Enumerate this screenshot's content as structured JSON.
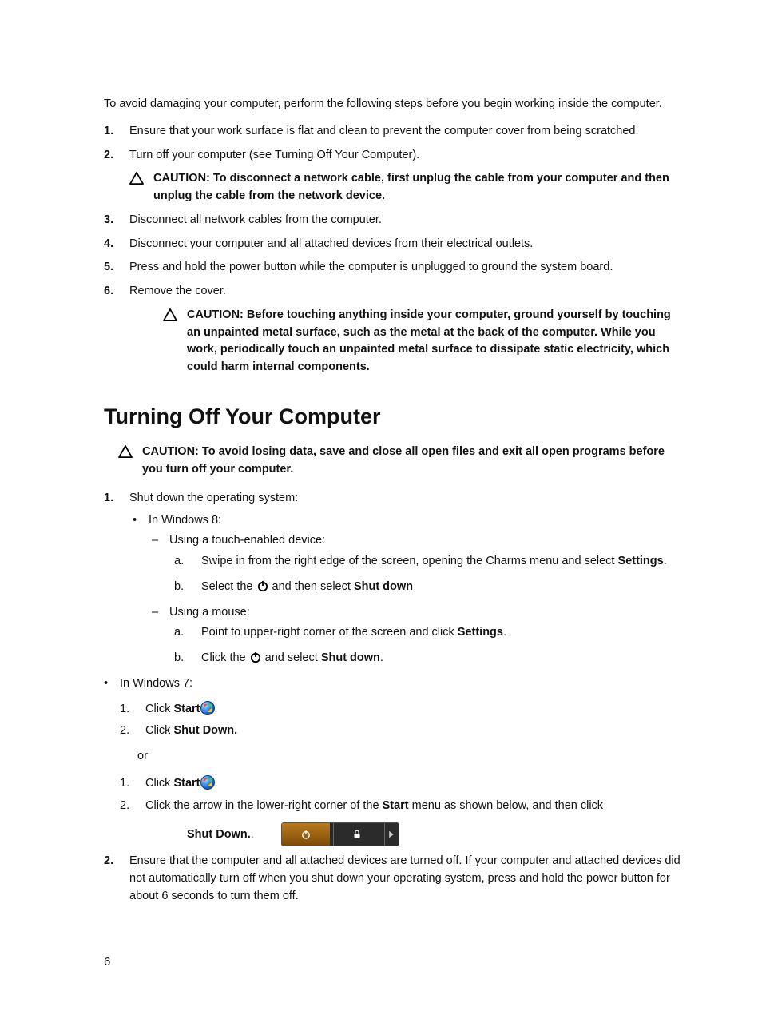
{
  "intro": "To avoid damaging your computer, perform the following steps before you begin working inside the computer.",
  "steps": {
    "s1": "Ensure that your work surface is flat and clean to prevent the computer cover from being scratched.",
    "s2": "Turn off your computer (see Turning Off Your Computer).",
    "caution1": "CAUTION: To disconnect a network cable, first unplug the cable from your computer and then unplug the cable from the network device.",
    "s3": "Disconnect all network cables from the computer.",
    "s4": "Disconnect your computer and all attached devices from their electrical outlets.",
    "s5": "Press and hold the power button while the computer is unplugged to ground the system board.",
    "s6": "Remove the cover.",
    "caution2": "CAUTION: Before touching anything inside your computer, ground yourself by touching an unpainted metal surface, such as the metal at the back of the computer. While you work, periodically touch an unpainted metal surface to dissipate static electricity, which could harm internal components."
  },
  "heading": "Turning Off Your Computer",
  "caution3": "CAUTION: To avoid losing data, save and close all open files and exit all open programs before you turn off your computer.",
  "shut": {
    "s1": "Shut down the operating system:",
    "win8": "In Windows 8:",
    "touch": "Using a touch-enabled device:",
    "t_a_pre": "Swipe in from the right edge of the screen, opening the Charms menu and select ",
    "t_a_bold": "Settings",
    "t_a_post": ".",
    "t_b_pre": "Select the ",
    "t_b_mid": " and then select ",
    "t_b_bold": "Shut down",
    "mouse": "Using a mouse:",
    "m_a_pre": "Point to upper-right corner of the screen and click ",
    "m_a_bold": "Settings",
    "m_a_post": ".",
    "m_b_pre": "Click the ",
    "m_b_mid": " and select ",
    "m_b_bold": "Shut down",
    "m_b_post": ".",
    "win7": "In Windows 7:",
    "w7_1_pre": "Click ",
    "w7_1_bold": "Start",
    "w7_1_post": ".",
    "w7_2_pre": "Click ",
    "w7_2_bold": "Shut Down.",
    "or": "or",
    "w7b_1_pre": "Click ",
    "w7b_1_bold": "Start",
    "w7b_1_post": ".",
    "w7b_2_pre": "Click the arrow in the lower-right corner of the ",
    "w7b_2_bold": "Start",
    "w7b_2_post": " menu as shown below, and then click ",
    "w7b_2_bold2": "Shut Down.",
    "w7b_2_post2": ".",
    "s2": "Ensure that the computer and all attached devices are turned off. If your computer and attached devices did not automatically turn off when you shut down your operating system, press and hold the power button for about 6 seconds to turn them off."
  },
  "pageNumber": "6"
}
